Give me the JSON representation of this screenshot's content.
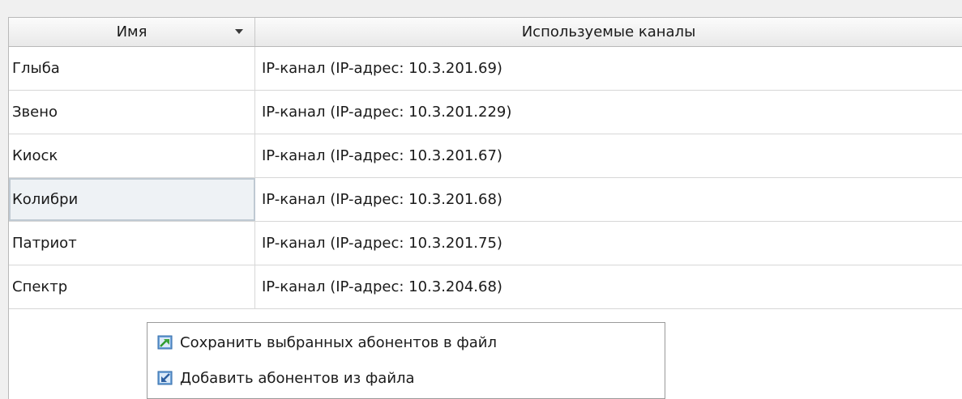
{
  "table": {
    "columns": [
      {
        "label": "Имя",
        "sorted": true
      },
      {
        "label": "Используемые каналы"
      }
    ],
    "rows": [
      {
        "name": "Глыба",
        "channel": "IP-канал (IP-адрес: 10.3.201.69)"
      },
      {
        "name": "Звено",
        "channel": "IP-канал (IP-адрес: 10.3.201.229)"
      },
      {
        "name": "Киоск",
        "channel": "IP-канал (IP-адрес: 10.3.201.67)"
      },
      {
        "name": "Колибри",
        "channel": "IP-канал (IP-адрес: 10.3.201.68)",
        "selected": true
      },
      {
        "name": "Патриот",
        "channel": "IP-канал (IP-адрес: 10.3.201.75)"
      },
      {
        "name": "Спектр",
        "channel": "IP-канал (IP-адрес: 10.3.204.68)"
      }
    ]
  },
  "context_menu": {
    "items": [
      {
        "label": "Сохранить выбранных абонентов в файл",
        "icon": "save-to-file-icon"
      },
      {
        "label": "Добавить абонентов из файла",
        "icon": "import-from-file-icon"
      }
    ]
  },
  "colors": {
    "selection_bg": "#eef2f5",
    "icon_blue": "#3b7dc4",
    "icon_green": "#3aa53a"
  }
}
